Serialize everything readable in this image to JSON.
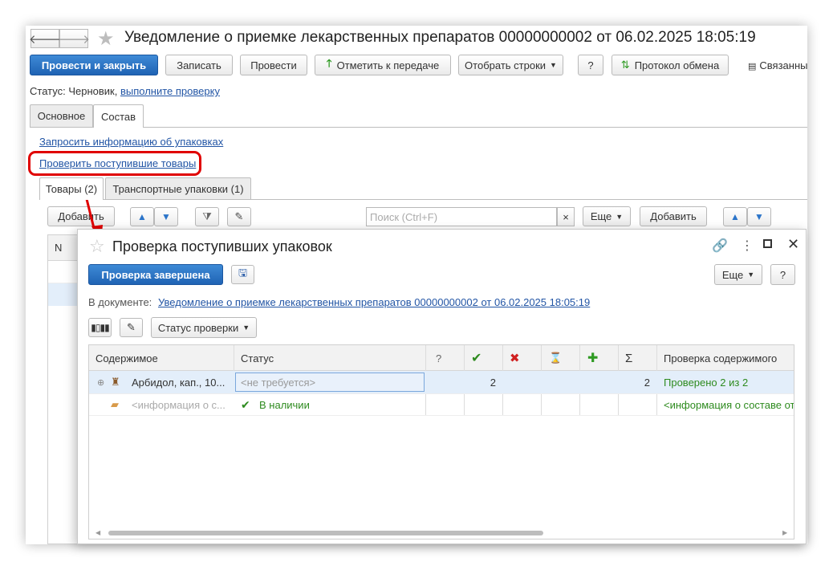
{
  "window": {
    "title": "Уведомление о приемке лекарственных препаратов 00000000002 от 06.02.2025 18:05:19",
    "toolbar": {
      "post_close": "Провести и закрыть",
      "save": "Записать",
      "post": "Провести",
      "mark_transfer": "Отметить к передаче",
      "select_rows": "Отобрать строки",
      "help": "?",
      "exchange_log": "Протокол обмена",
      "related": "Связанны"
    },
    "status_label": "Статус:",
    "status_value": "Черновик,",
    "status_link": "выполните проверку",
    "tabs": [
      "Основное",
      "Состав"
    ],
    "links": {
      "request_pack_info": "Запросить информацию об упаковках",
      "check_goods": "Проверить поступившие товары"
    },
    "subtabs": [
      "Товары (2)",
      "Транспортные упаковки (1)"
    ],
    "list_toolbar": {
      "add": "Добавить",
      "search_placeholder": "Поиск (Ctrl+F)",
      "clear": "×",
      "more": "Еще",
      "add2": "Добавить"
    },
    "table_header_n": "N"
  },
  "dialog": {
    "title": "Проверка поступивших упаковок",
    "done_button": "Проверка завершена",
    "more": "Еще",
    "help": "?",
    "doc_label": "В документе:",
    "doc_link": "Уведомление о приемке лекарственных препаратов 00000000002 от 06.02.2025 18:05:19",
    "check_status": "Статус проверки",
    "columns": [
      "Содержимое",
      "Статус",
      "?",
      "✔",
      "✖",
      "⌛",
      "✚",
      "Σ",
      "Проверка содержимого"
    ],
    "rows": [
      {
        "content": "Арбидол, кап., 10...",
        "status": "<не требуется>",
        "q": "",
        "ok": "2",
        "bad": "",
        "wait": "",
        "plus": "",
        "sum": "2",
        "check": "Проверено 2 из 2"
      },
      {
        "content": "<информация о с...",
        "status": "В наличии",
        "q": "",
        "ok": "",
        "bad": "",
        "wait": "",
        "plus": "",
        "sum": "",
        "check": "<информация о составе от"
      }
    ]
  },
  "colors": {
    "accent": "#1f63b4",
    "highlight": "#e00000",
    "selected_row": "#e3eefa",
    "ok_green": "#2e8b1f",
    "bad_red": "#d02020"
  }
}
